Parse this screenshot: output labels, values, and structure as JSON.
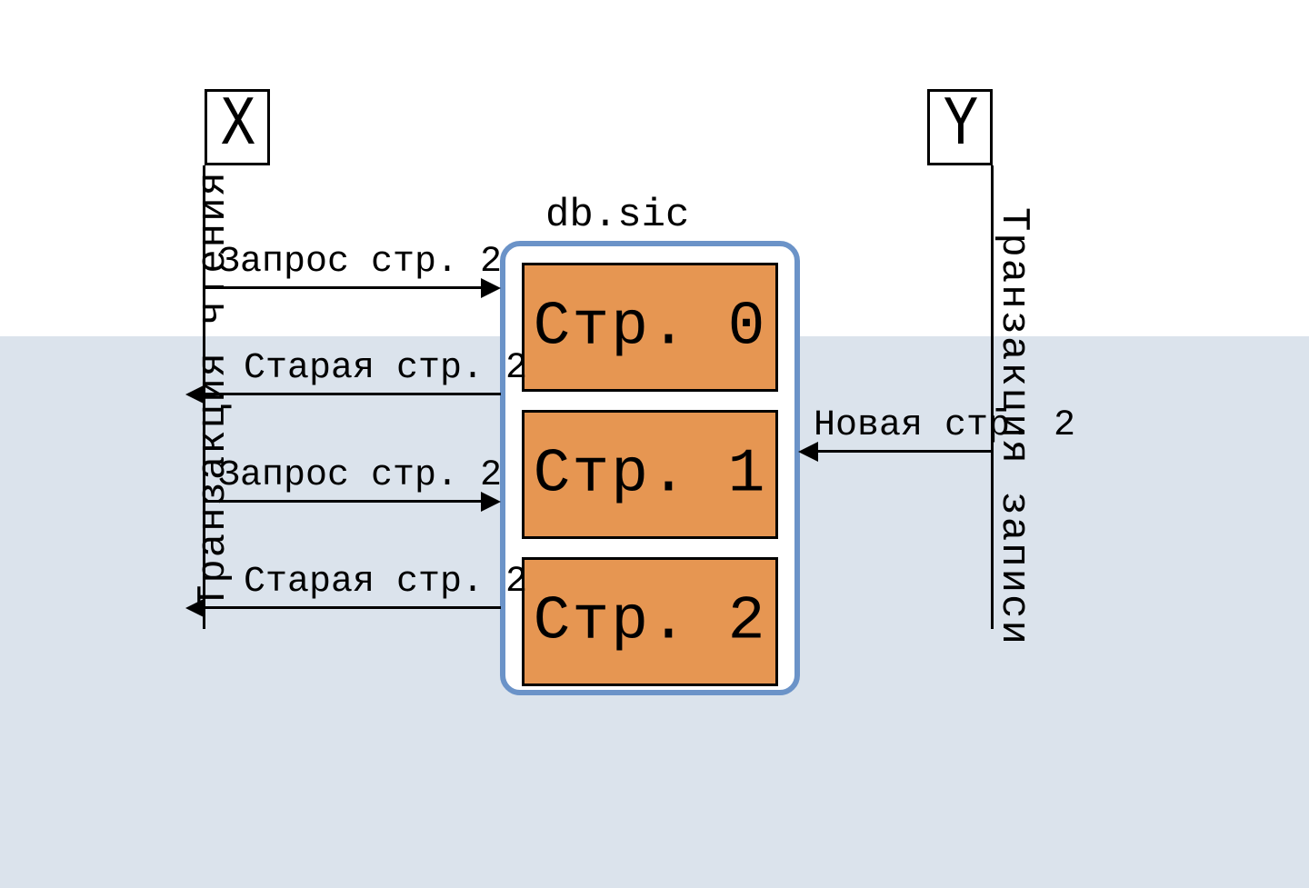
{
  "actors": {
    "x": {
      "label": "X",
      "lifeline_label": "Транзакция чтения"
    },
    "y": {
      "label": "Y",
      "lifeline_label": "Транзакция записи"
    }
  },
  "database": {
    "label": "db.sic",
    "pages": [
      "Стр. 0",
      "Стр. 1",
      "Стр. 2"
    ]
  },
  "arrows": {
    "left": [
      {
        "text": "Запрос стр. 2",
        "dir": "right"
      },
      {
        "text": "Старая стр. 2",
        "dir": "left"
      },
      {
        "text": "Запрос стр. 2",
        "dir": "right"
      },
      {
        "text": "Старая стр. 2",
        "dir": "left"
      }
    ],
    "right": [
      {
        "text": "Новая стр. 2",
        "dir": "left"
      }
    ]
  },
  "colors": {
    "page_fill": "#e69652",
    "db_border": "#6b93c8",
    "bg_lower": "#dbe3ec"
  }
}
